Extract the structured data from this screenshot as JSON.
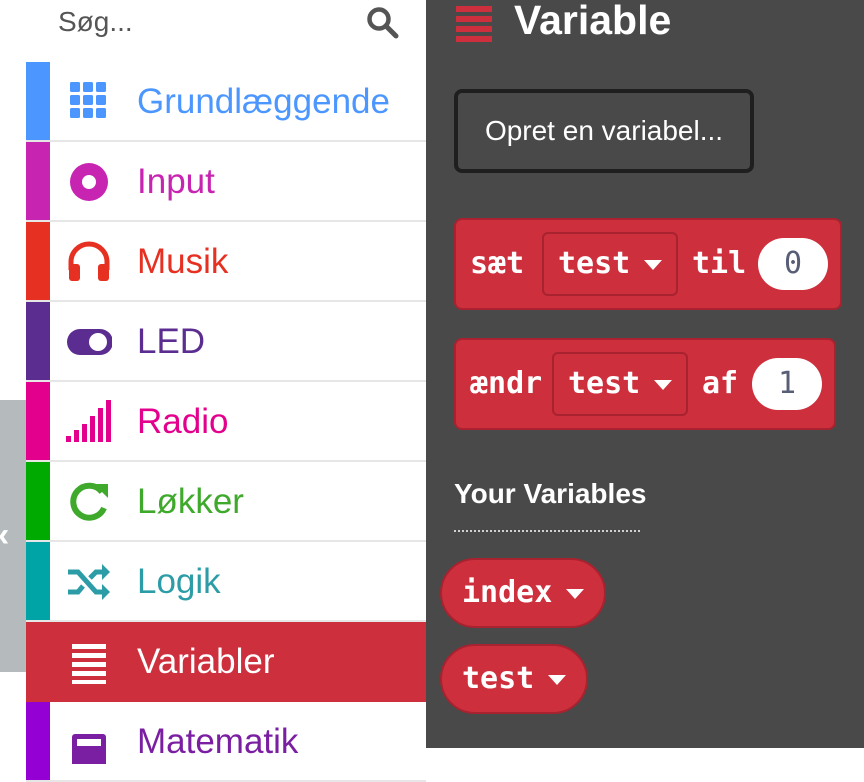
{
  "search": {
    "placeholder": "Søg..."
  },
  "categories": [
    {
      "label": "Grundlæggende",
      "color": "#4C97FF",
      "icon": "grid-icon"
    },
    {
      "label": "Input",
      "color": "#C724B1",
      "icon": "radio-button-icon"
    },
    {
      "label": "Musik",
      "color": "#E63022",
      "icon": "headphones-icon"
    },
    {
      "label": "LED",
      "color": "#5C2D91",
      "icon": "toggle-icon"
    },
    {
      "label": "Radio",
      "color": "#E3008C",
      "icon": "signal-bars-icon"
    },
    {
      "label": "Løkker",
      "color": "#00AA00",
      "icon": "refresh-icon"
    },
    {
      "label": "Logik",
      "color": "#00A4A6",
      "icon": "shuffle-icon"
    },
    {
      "label": "Variabler",
      "color": "#DC143C",
      "icon": "list-lines-icon",
      "active": true
    },
    {
      "label": "Matematik",
      "color": "#9400D3",
      "icon": "calculator-icon"
    }
  ],
  "flyout": {
    "title": "Variable",
    "create_button": "Opret en variabel...",
    "set_block": {
      "keyword": "sæt",
      "variable": "test",
      "to": "til",
      "value": "0"
    },
    "change_block": {
      "keyword": "ændr",
      "variable": "test",
      "by": "af",
      "value": "1"
    },
    "your_variables": "Your Variables",
    "variables": [
      "index",
      "test"
    ]
  },
  "colors": {
    "accent": "#CD2F3D",
    "flyout_bg": "#4A4949"
  }
}
